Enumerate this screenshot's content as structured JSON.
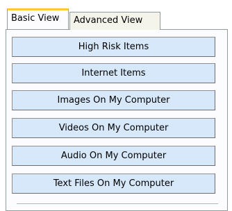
{
  "tabs": [
    {
      "label": "Basic View",
      "active": true
    },
    {
      "label": "Advanced View",
      "active": false
    }
  ],
  "buttons": [
    {
      "label": "High Risk Items"
    },
    {
      "label": "Internet Items"
    },
    {
      "label": "Images On My Computer"
    },
    {
      "label": "Videos On My Computer"
    },
    {
      "label": "Audio On My Computer"
    },
    {
      "label": "Text Files On My Computer"
    }
  ],
  "colors": {
    "button_fill": "#d6e8fa",
    "active_tab_accent": "#ffc83c",
    "border": "#919b9c"
  }
}
